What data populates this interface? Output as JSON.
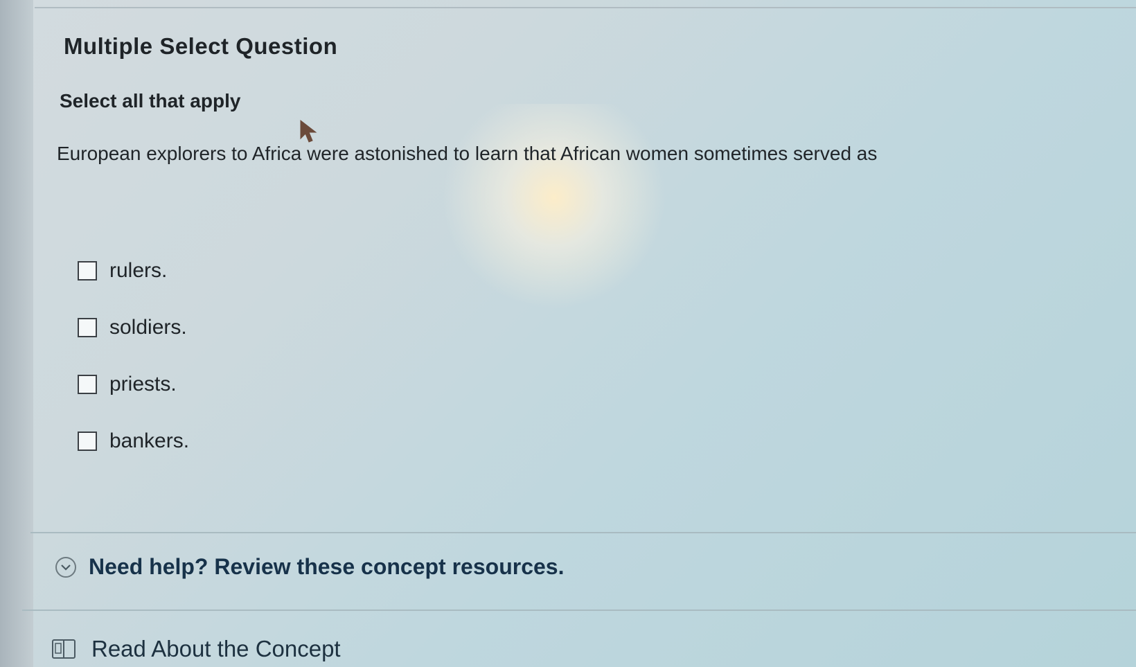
{
  "question": {
    "type_title": "Multiple Select Question",
    "instruction": "Select all that apply",
    "prompt": "European explorers to Africa were astonished to learn that African women sometimes served as"
  },
  "options": [
    {
      "label": "rulers.",
      "checked": false
    },
    {
      "label": "soldiers.",
      "checked": false
    },
    {
      "label": "priests.",
      "checked": false
    },
    {
      "label": "bankers.",
      "checked": false
    }
  ],
  "help": {
    "toggle_label": "Need help? Review these concept resources.",
    "toggle_icon": "chevron-down-circle-icon",
    "resources": [
      {
        "label": "Read About the Concept",
        "icon": "book-icon"
      }
    ]
  }
}
